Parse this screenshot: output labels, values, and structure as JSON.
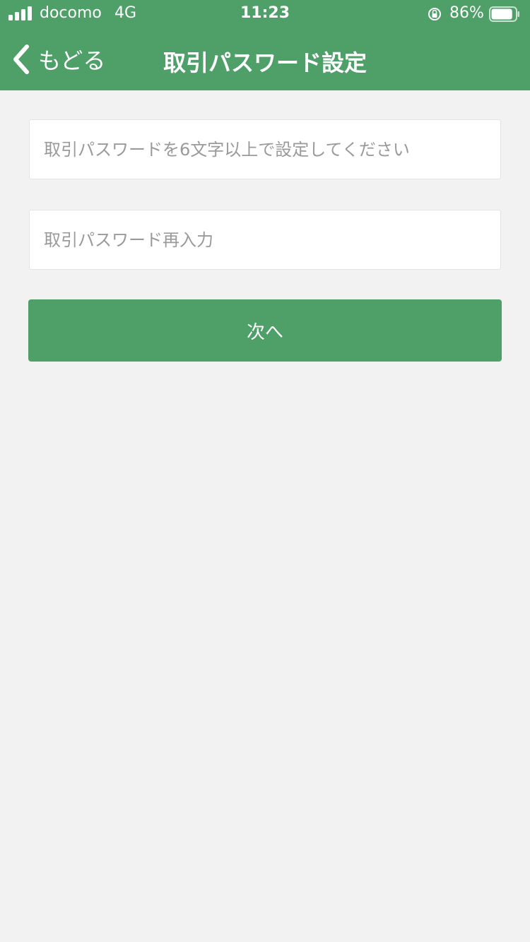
{
  "status_bar": {
    "carrier": "docomo",
    "network": "4G",
    "time": "11:23",
    "battery_percent": "86%",
    "battery_level": 0.86,
    "icons": [
      "signal-bars-icon",
      "orientation-lock-icon",
      "battery-icon"
    ]
  },
  "nav": {
    "back_label": "もどる",
    "title": "取引パスワード設定"
  },
  "form": {
    "password_placeholder": "取引パスワードを6文字以上で設定してください",
    "password_value": "",
    "confirm_placeholder": "取引パスワード再入力",
    "confirm_value": "",
    "next_label": "次へ"
  },
  "colors": {
    "accent": "#4f9f68",
    "background": "#f2f2f2"
  }
}
